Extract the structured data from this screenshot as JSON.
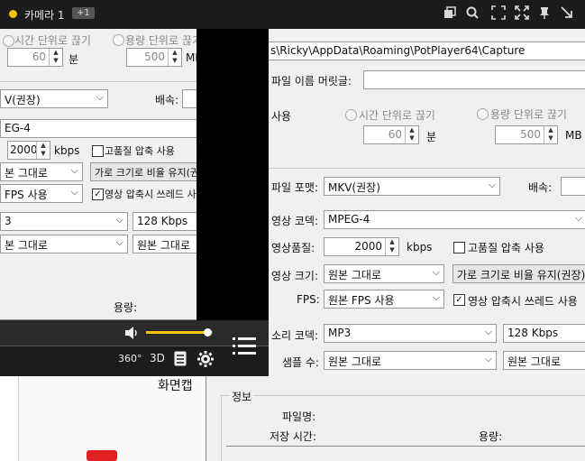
{
  "window": {
    "title": "카메라 1",
    "badge": "+1"
  },
  "toolbar_icons": [
    "windows-icon",
    "search-icon",
    "fit-icon",
    "expand-icon",
    "pin-icon",
    "minimize-icon"
  ],
  "dialog": {
    "path": "s\\Ricky\\AppData\\Roaming\\PotPlayer64\\Capture",
    "prefix_label": "파일 이름 머릿글:",
    "prefix_value": "",
    "split_label": "사용",
    "split_time": "시간 단위로 끊기",
    "split_size": "용량 단위로 끊기",
    "time_value": "60",
    "time_unit": "분",
    "size_value": "500",
    "size_unit": "MB",
    "format_label": "파일 포맷:",
    "format_value": "MKV(권장)",
    "speed_label": "배속:",
    "video_codec_label": "영상 코덱:",
    "video_codec_value": "MPEG-4",
    "quality_label": "영상품질:",
    "quality_value": "2000",
    "quality_unit": "kbps",
    "hq_label": "고품질 압축 사용",
    "size_label": "영상 크기:",
    "size_sel": "원본 그대로",
    "ratio_btn": "가로 크기로 비율 유지(권장)",
    "fps_label": "FPS:",
    "fps_value": "원본 FPS 사용",
    "thread_label": "영상 압축시 쓰레드 사용",
    "audio_codec_label": "소리 코덱:",
    "audio_codec_value": "MP3",
    "bitrate_value": "128 Kbps",
    "sample_label": "샘플 수:",
    "sample_value": "원본 그대로",
    "channel_value": "원본 그대로",
    "info_label": "정보",
    "filename_label": "파일명:",
    "savetime_label": "저장 시간:",
    "capacity_label": "용량:"
  },
  "left": {
    "split_time": "시간 단위로 끊기",
    "split_size": "용량 단위로 끊기",
    "time_value": "60",
    "time_unit": "분",
    "size_value": "500",
    "size_unit": "MB",
    "format_value": "V(권장)",
    "speed_label": "배속:",
    "video_codec_value": "EG-4",
    "quality_value": "2000",
    "quality_unit": "kbps",
    "hq_label": "고품질 압축 사용",
    "size_sel": "본 그대로",
    "ratio_btn": "가로 크기로 비율 유지(권",
    "fps_value": "FPS 사용",
    "thread_label": "영상 압축시 쓰레드 사",
    "audio_codec_value": "3",
    "bitrate_value": "128 Kbps",
    "sample_value": "본 그대로",
    "channel_value": "원본 그대로",
    "capacity_label": "용량:"
  },
  "player": {
    "volume": 0.92,
    "btn_360": "360°",
    "btn_3d": "3D"
  },
  "bottom": {
    "capture_text": "화면캡"
  },
  "colors": {
    "accent": "#f3c400",
    "titlebar": "#1b1b1b",
    "dialog_bg": "#f0f0f0"
  }
}
